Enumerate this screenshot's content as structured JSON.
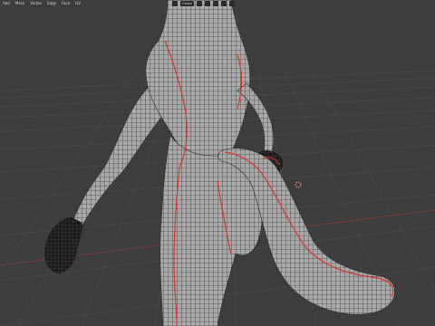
{
  "menu": {
    "items": [
      "Add",
      "Mesh",
      "Vertex",
      "Edge",
      "Face",
      "UV"
    ]
  },
  "header": {
    "orientation_label": "Global"
  },
  "colors": {
    "background": "#3d3d3d",
    "grid": "#4a4a4a",
    "mesh_fill": "#a9a9a9",
    "wire": "#1e1e1e",
    "seam": "#d8342a"
  },
  "icons": {
    "cursor": "3d-cursor-icon",
    "snap": "magnet-icon",
    "proportional": "target-icon"
  }
}
